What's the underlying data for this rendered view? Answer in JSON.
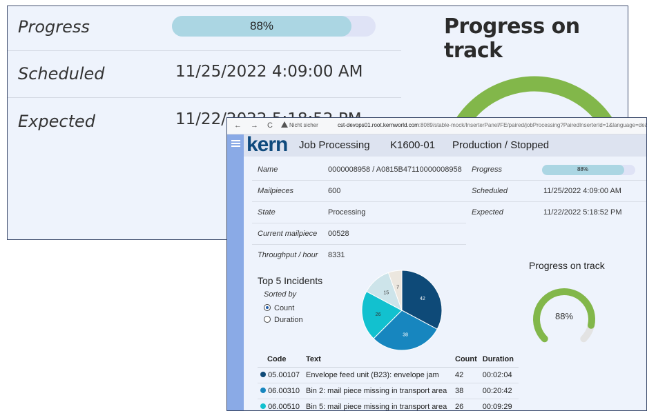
{
  "zoomed": {
    "progress_label": "Progress",
    "progress_text": "88%",
    "progress_fraction": 0.88,
    "scheduled_label": "Scheduled",
    "scheduled_value": "11/25/2022 4:09:00 AM",
    "expected_label": "Expected",
    "expected_value": "11/22/2022 5:18:52 PM",
    "gauge_title": "Progress on track"
  },
  "browser": {
    "back": "←",
    "forward": "→",
    "reload": "C",
    "security": "Nicht sicher",
    "url_host": "cst-devops01.root.kernworld.com",
    "url_path": ":8089/stable-mock/InserterPanel/FE/paired/jobProcessing?PairedInserterId=1&language=de&aut"
  },
  "header": {
    "logo": "kern",
    "title": "Job Processing",
    "machine": "K1600-01",
    "status": "Production / Stopped"
  },
  "job": {
    "name_label": "Name",
    "name_value": "0000008958 / A0815B47110000008958",
    "mailpieces_label": "Mailpieces",
    "mailpieces_value": "600",
    "state_label": "State",
    "state_value": "Processing",
    "current_label": "Current mailpiece",
    "current_value": "00528",
    "throughput_label": "Throughput / hour",
    "throughput_value": "8331",
    "progress_label": "Progress",
    "progress_text": "88%",
    "progress_fraction": 0.88,
    "scheduled_label": "Scheduled",
    "scheduled_value": "11/25/2022 4:09:00 AM",
    "expected_label": "Expected",
    "expected_value": "11/22/2022 5:18:52 PM"
  },
  "gauge": {
    "title": "Progress on track",
    "value_text": "88%",
    "fraction": 0.88,
    "color": "#82b74a"
  },
  "incidents": {
    "title": "Top 5 Incidents",
    "sorted_by_label": "Sorted by",
    "options": [
      "Count",
      "Duration"
    ],
    "selected": "Count",
    "columns": [
      "Code",
      "Text",
      "Count",
      "Duration"
    ],
    "rows": [
      {
        "code": "05.00107",
        "text": "Envelope feed unit (B23): envelope jam",
        "count": "42",
        "duration": "00:02:04",
        "color": "#0e4a78"
      },
      {
        "code": "06.00310",
        "text": "Bin 2: mail piece missing in transport area",
        "count": "38",
        "duration": "00:20:42",
        "color": "#1786bf"
      },
      {
        "code": "06.00510",
        "text": "Bin 5: mail piece missing in transport area",
        "count": "26",
        "duration": "00:09:29",
        "color": "#12c1cf"
      }
    ]
  },
  "chart_data": {
    "type": "pie",
    "values": [
      42,
      38,
      26,
      15,
      7
    ],
    "labels": [
      "42",
      "38",
      "26",
      "15",
      "7"
    ],
    "colors": [
      "#0e4a78",
      "#1786bf",
      "#12c1cf",
      "#cde4ea",
      "#ece7df"
    ]
  }
}
